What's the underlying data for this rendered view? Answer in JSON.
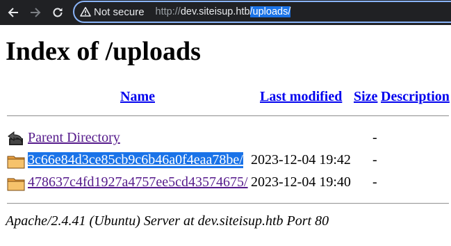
{
  "browser": {
    "security_label": "Not secure",
    "url_prefix": "http://",
    "url_host": "dev.siteisup.htb",
    "url_path": "/uploads/",
    "icons": {
      "back": "arrow-left-icon",
      "forward": "arrow-right-icon",
      "reload": "reload-icon",
      "security": "warning-triangle-icon"
    }
  },
  "page": {
    "title": "Index of /uploads",
    "columns": {
      "name": "Name",
      "modified": "Last modified",
      "size": "Size",
      "description": "Description"
    },
    "parent": {
      "label": "Parent Directory",
      "size": "-",
      "icon": "back-folder-icon"
    },
    "entries": [
      {
        "name": "3c66e84d3ce85cb9c6b46a0f4eaa78be/",
        "modified": "2023-12-04 19:42",
        "size": "-",
        "icon": "folder-icon",
        "selected": true
      },
      {
        "name": "478637c4fd1927a4757ee5cd43574675/",
        "modified": "2023-12-04 19:40",
        "size": "-",
        "icon": "folder-icon",
        "selected": false
      }
    ],
    "footer": "Apache/2.4.41 (Ubuntu) Server at dev.siteisup.htb Port 80"
  }
}
